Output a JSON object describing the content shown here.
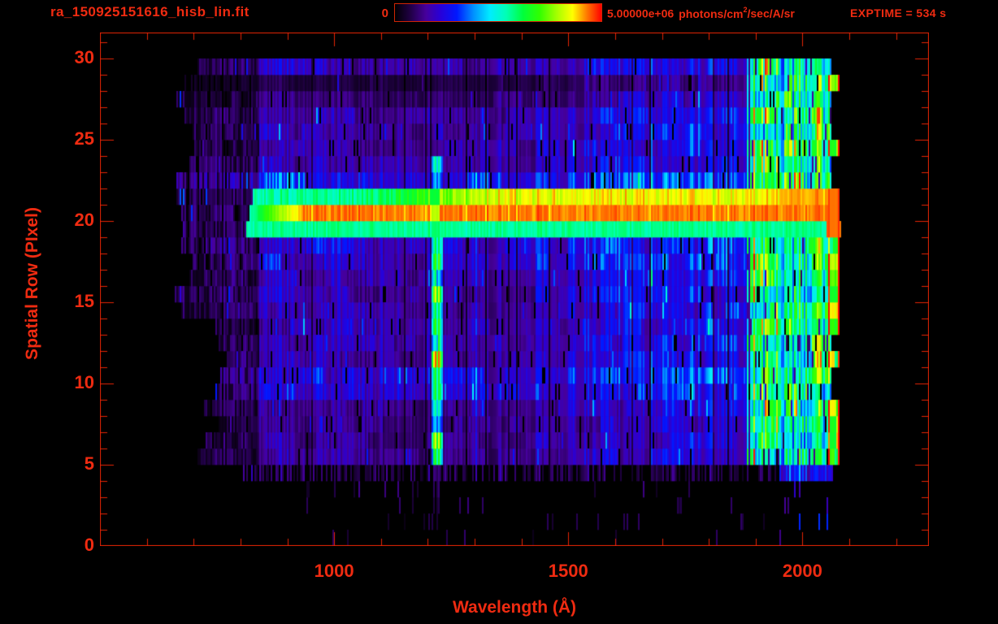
{
  "header": {
    "title": "ra_150925151616_hisb_lin.fit",
    "colorbar_min_label": "0",
    "flux_max_value": "5.00000e+06",
    "flux_units_pre": "photons/cm",
    "flux_units_sup": "2",
    "flux_units_post": "/sec/A/sr",
    "exptime_label": "EXPTIME = 534 s"
  },
  "colors": {
    "background": "#000000",
    "accent_text": "#ef2b11",
    "frame": "#e62404"
  },
  "chart_data": {
    "type": "heatmap",
    "title": "ra_150925151616_hisb_lin.fit",
    "xlabel": "Wavelength (Å)",
    "ylabel": "Spatial Row (PIxel)",
    "xlim": [
      500,
      2270
    ],
    "ylim": [
      0,
      31.6
    ],
    "x_major_ticks": [
      1000,
      1500,
      2000
    ],
    "x_minor_tick_step": 100,
    "x_minor_tick_range": [
      600,
      2200
    ],
    "y_major_ticks": [
      0,
      5,
      10,
      15,
      20,
      25,
      30
    ],
    "y_minor_tick_step": 1,
    "grid": false,
    "legend_position": "colorbar-top",
    "colorbar": {
      "min": 0,
      "max": 5000000,
      "min_label": "0",
      "max_label": "5.00000e+06 photons/cm2/sec/A/sr",
      "units": "photons/cm2/sec/A/sr",
      "stops": [
        [
          0.0,
          "#000000"
        ],
        [
          0.07,
          "#1e0040"
        ],
        [
          0.15,
          "#46009c"
        ],
        [
          0.22,
          "#2800d8"
        ],
        [
          0.3,
          "#0018ff"
        ],
        [
          0.38,
          "#0090ff"
        ],
        [
          0.46,
          "#00ecff"
        ],
        [
          0.54,
          "#00ffb4"
        ],
        [
          0.62,
          "#00ff3c"
        ],
        [
          0.7,
          "#30ff00"
        ],
        [
          0.78,
          "#a0ff00"
        ],
        [
          0.86,
          "#ffff00"
        ],
        [
          0.93,
          "#ff7800"
        ],
        [
          1.0,
          "#ff0000"
        ]
      ]
    },
    "exptime_seconds": 534,
    "features": {
      "seed": 20150925,
      "detector_wavelength_range_A": [
        660,
        2076
      ],
      "rows_with_signal": [
        0,
        29
      ],
      "background_level_frac": 0.17,
      "green_band": {
        "row": 19,
        "start_A": 812,
        "level_frac": 0.56
      },
      "red_band": {
        "row": 20,
        "start_A": 816,
        "level_frac": 0.97
      },
      "mottled_band": {
        "row": 21,
        "start_A": 825,
        "level_frac": 0.82
      },
      "cyan_row": {
        "row": 22,
        "boost_frac": 0.1
      },
      "lyman_alpha_line": {
        "wavelength_A": 1216,
        "rows": [
          5,
          23
        ],
        "level_frac": 0.65
      },
      "oi_line": {
        "wavelength_A": 1302,
        "rows": [
          5,
          22
        ],
        "boost_frac": 0.08
      },
      "long_wavelength_bright_zone": {
        "start_A": 1880,
        "end_A": 2052,
        "level_frac": 0.55
      },
      "red_edge": {
        "start_A": 2052,
        "end_A": 2076
      },
      "dark_bottom_rows": [
        0,
        4
      ],
      "dark_top_row": 28
    }
  }
}
